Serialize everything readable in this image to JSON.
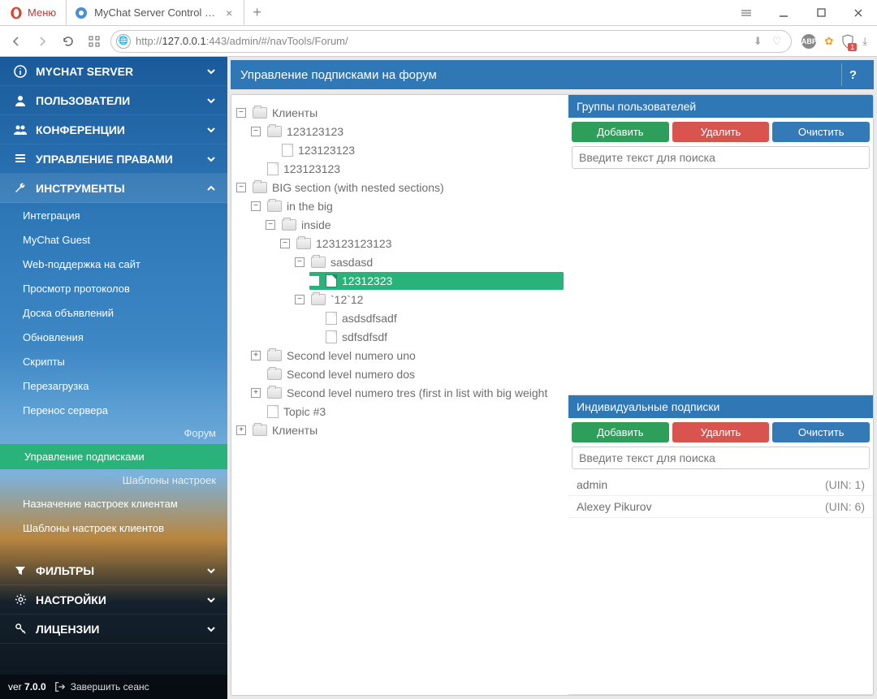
{
  "browser": {
    "menu_label": "Меню",
    "tab_title": "MyChat Server Control Pan",
    "url_host": "http://",
    "url_ip": "127.0.0.1",
    "url_path": ":443/admin/#/navTools/Forum/",
    "shield_badge": "1"
  },
  "sidebar": {
    "items": [
      {
        "label": "MYCHAT SERVER",
        "icon": "info"
      },
      {
        "label": "ПОЛЬЗОВАТЕЛИ",
        "icon": "user"
      },
      {
        "label": "КОНФЕРЕНЦИИ",
        "icon": "users"
      },
      {
        "label": "УПРАВЛЕНИЕ ПРАВАМИ",
        "icon": "list"
      },
      {
        "label": "ИНСТРУМЕНТЫ",
        "icon": "wrench",
        "expanded": true
      }
    ],
    "tools_sub": [
      "Интеграция",
      "MyChat Guest",
      "Web-поддержка на сайт",
      "Просмотр протоколов",
      "Доска объявлений",
      "Обновления",
      "Скрипты",
      "Перезагрузка",
      "Перенос сервера"
    ],
    "forum_label": "Форум",
    "forum_sub_active": "Управление подписками",
    "forum_sub2": "Шаблоны настроек",
    "extra_sub": [
      "Назначение настроек клиентам",
      "Шаблоны настроек клиентов"
    ],
    "bottom": [
      {
        "label": "ФИЛЬТРЫ",
        "icon": "filter"
      },
      {
        "label": "НАСТРОЙКИ",
        "icon": "gear"
      },
      {
        "label": "ЛИЦЕНЗИИ",
        "icon": "key"
      }
    ],
    "version_label": "ver",
    "version": "7.0.0",
    "logout": "Завершить сеанс"
  },
  "header_title": "Управление подписками на форум",
  "help_symbol": "?",
  "tree": {
    "root": [
      {
        "t": "folder",
        "exp": "-",
        "label": "Клиенты",
        "children": [
          {
            "t": "folder",
            "exp": "-",
            "label": "123123123",
            "children": [
              {
                "t": "file",
                "label": "123123123"
              }
            ]
          },
          {
            "t": "file",
            "label": "123123123"
          }
        ]
      },
      {
        "t": "folder",
        "exp": "-",
        "label": "BIG section (with nested sections)",
        "children": [
          {
            "t": "folder",
            "exp": "-",
            "label": "in the big",
            "children": [
              {
                "t": "folder",
                "exp": "-",
                "label": "inside",
                "children": [
                  {
                    "t": "folder",
                    "exp": "-",
                    "label": "123123123123",
                    "children": [
                      {
                        "t": "folder",
                        "exp": "-",
                        "label": "sasdasd",
                        "children": [
                          {
                            "t": "file",
                            "label": "12312323",
                            "selected": true
                          }
                        ]
                      },
                      {
                        "t": "folder",
                        "exp": "-",
                        "label": "`12`12",
                        "children": [
                          {
                            "t": "file",
                            "label": "asdsdfsadf"
                          },
                          {
                            "t": "file",
                            "label": "sdfsdfsdf"
                          }
                        ]
                      }
                    ]
                  }
                ]
              }
            ]
          },
          {
            "t": "folder",
            "exp": "+",
            "label": "Second level numero uno"
          },
          {
            "t": "folder",
            "exp": "",
            "label": "Second level numero dos"
          },
          {
            "t": "folder",
            "exp": "+",
            "label": "Second level numero tres (first in list with big weight"
          },
          {
            "t": "file",
            "label": "Topic #3"
          }
        ]
      },
      {
        "t": "folder",
        "exp": "+",
        "label": "Клиенты"
      }
    ]
  },
  "groups": {
    "title": "Группы пользователей",
    "add": "Добавить",
    "del": "Удалить",
    "clr": "Очистить",
    "search_placeholder": "Введите текст для поиска",
    "items": []
  },
  "indiv": {
    "title": "Индивидуальные подписки",
    "add": "Добавить",
    "del": "Удалить",
    "clr": "Очистить",
    "search_placeholder": "Введите текст для поиска",
    "items": [
      {
        "name": "admin",
        "uin": "(UIN: 1)"
      },
      {
        "name": "Alexey Pikurov",
        "uin": "(UIN: 6)"
      }
    ]
  }
}
